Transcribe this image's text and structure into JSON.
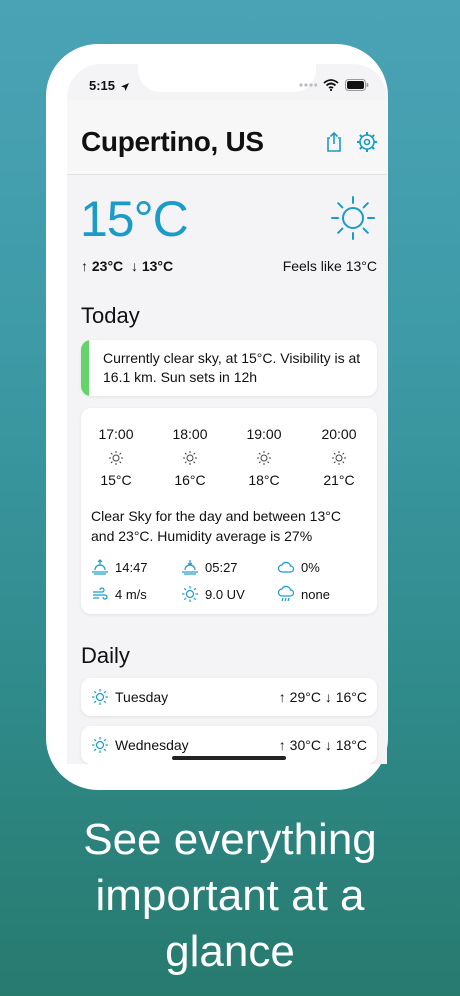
{
  "status_bar": {
    "time": "5:15"
  },
  "header": {
    "city": "Cupertino, US"
  },
  "current": {
    "temperature": "15°C",
    "high": "↑ 23°C",
    "low": "↓ 13°C",
    "feels_like": "Feels like 13°C"
  },
  "today": {
    "title": "Today",
    "summary": "Currently clear sky, at 15°C. Visibility is at 16.1 km. Sun sets in 12h",
    "hourly": [
      {
        "time": "17:00",
        "temp": "15°C"
      },
      {
        "time": "18:00",
        "temp": "16°C"
      },
      {
        "time": "19:00",
        "temp": "18°C"
      },
      {
        "time": "20:00",
        "temp": "21°C"
      }
    ],
    "description": "Clear Sky for the day and between 13°C and 23°C. Humidity average is 27%",
    "stats": {
      "sunrise": "14:47",
      "sunset": "05:27",
      "cloud": "0%",
      "wind": "4 m/s",
      "uv": "9.0 UV",
      "precipitation": "none"
    }
  },
  "daily": {
    "title": "Daily",
    "days": [
      {
        "name": "Tuesday",
        "range": "↑ 29°C ↓ 16°C"
      },
      {
        "name": "Wednesday",
        "range": "↑ 30°C ↓ 18°C"
      }
    ]
  },
  "caption": {
    "line1": "See everything",
    "line2": "important at a",
    "line3": "glance"
  },
  "colors": {
    "accent": "#1a9cc6",
    "summary_bar": "#63d46a",
    "icon": "#1a9cc6"
  }
}
